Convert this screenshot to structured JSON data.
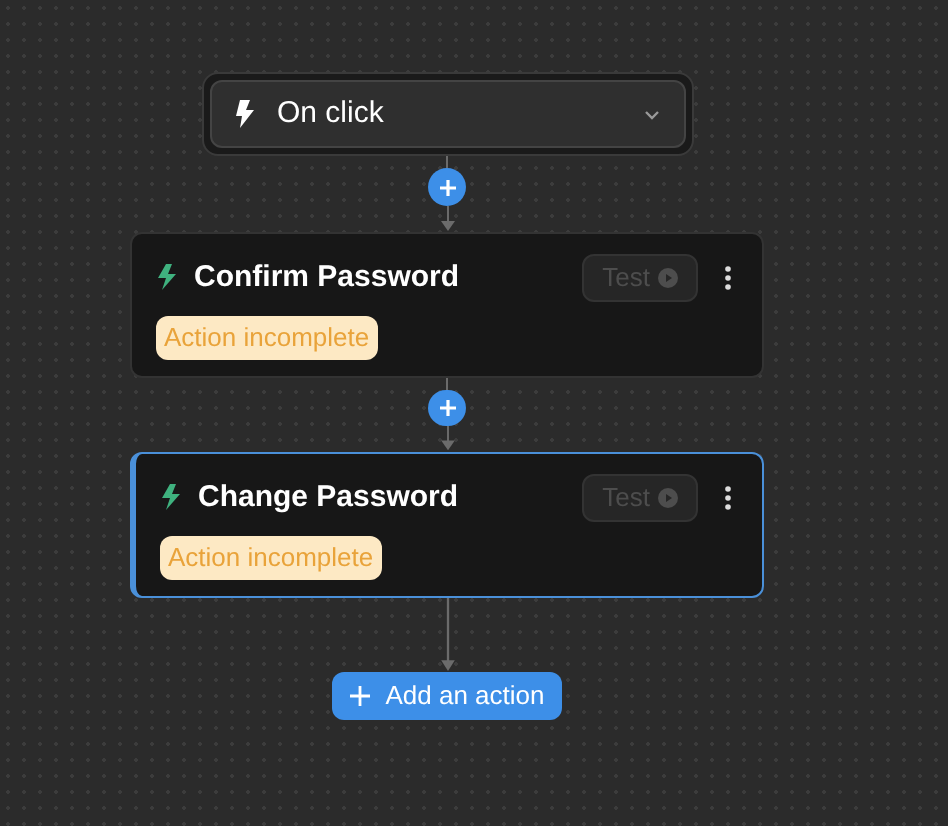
{
  "trigger": {
    "label": "On click"
  },
  "actions": [
    {
      "title": "Confirm Password",
      "status": "Action incomplete",
      "test_label": "Test",
      "selected": false
    },
    {
      "title": "Change Password",
      "status": "Action incomplete",
      "test_label": "Test",
      "selected": true
    }
  ],
  "add_button": {
    "label": "Add an action"
  }
}
